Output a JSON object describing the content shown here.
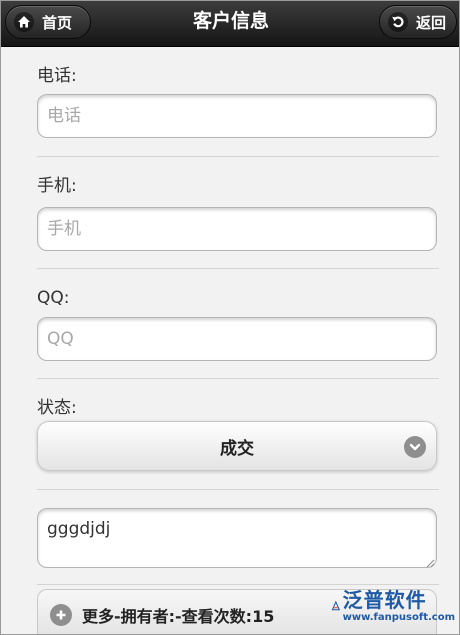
{
  "header": {
    "title": "客户信息",
    "home_label": "首页",
    "back_label": "返回",
    "home_icon": "home-icon",
    "back_icon": "back-arrow-icon"
  },
  "form": {
    "phone": {
      "label": "电话:",
      "placeholder": "电话",
      "value": ""
    },
    "mobile": {
      "label": "手机:",
      "placeholder": "手机",
      "value": ""
    },
    "qq": {
      "label": "QQ:",
      "placeholder": "QQ",
      "value": ""
    },
    "status": {
      "label": "状态:",
      "selected": "成交",
      "icon": "chevron-down-icon"
    },
    "notes": {
      "value": "gggdjdj"
    },
    "more": {
      "label": "更多-拥有者:-查看次数:15",
      "icon": "plus-icon"
    }
  },
  "watermark": {
    "name": "泛普软件",
    "url": "www.fanpusoft.com"
  },
  "colors": {
    "header_bg": "#1e1e1e",
    "page_bg": "#f2f2f2",
    "watermark": "#1e5aa6"
  }
}
